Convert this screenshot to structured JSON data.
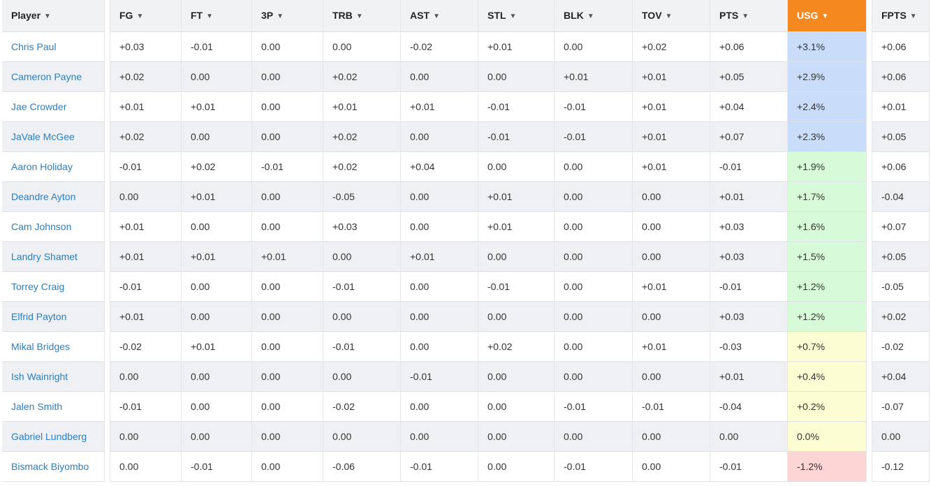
{
  "headers": {
    "player": "Player",
    "stats": [
      "FG",
      "FT",
      "3P",
      "TRB",
      "AST",
      "STL",
      "BLK",
      "TOV",
      "PTS",
      "USG"
    ],
    "fpts": "FPTS"
  },
  "sort_icon": "chevron-down-icon",
  "colors": {
    "active_sort": "#f5891f",
    "usg_blue": "#c9ddfb",
    "usg_green": "#d7fbd8",
    "usg_yellow": "#fdfdd3",
    "usg_red": "#fdd5d5",
    "player_link": "#2a7fc1"
  },
  "rows": [
    {
      "player": "Chris Paul",
      "stats": [
        "+0.03",
        "-0.01",
        "0.00",
        "0.00",
        "-0.02",
        "+0.01",
        "0.00",
        "+0.02",
        "+0.06",
        "+3.1%"
      ],
      "fpts": "+0.06",
      "usg_tier": "blue"
    },
    {
      "player": "Cameron Payne",
      "stats": [
        "+0.02",
        "0.00",
        "0.00",
        "+0.02",
        "0.00",
        "0.00",
        "+0.01",
        "+0.01",
        "+0.05",
        "+2.9%"
      ],
      "fpts": "+0.06",
      "usg_tier": "blue"
    },
    {
      "player": "Jae Crowder",
      "stats": [
        "+0.01",
        "+0.01",
        "0.00",
        "+0.01",
        "+0.01",
        "-0.01",
        "-0.01",
        "+0.01",
        "+0.04",
        "+2.4%"
      ],
      "fpts": "+0.01",
      "usg_tier": "blue"
    },
    {
      "player": "JaVale McGee",
      "stats": [
        "+0.02",
        "0.00",
        "0.00",
        "+0.02",
        "0.00",
        "-0.01",
        "-0.01",
        "+0.01",
        "+0.07",
        "+2.3%"
      ],
      "fpts": "+0.05",
      "usg_tier": "blue"
    },
    {
      "player": "Aaron Holiday",
      "stats": [
        "-0.01",
        "+0.02",
        "-0.01",
        "+0.02",
        "+0.04",
        "0.00",
        "0.00",
        "+0.01",
        "-0.01",
        "+1.9%"
      ],
      "fpts": "+0.06",
      "usg_tier": "green"
    },
    {
      "player": "Deandre Ayton",
      "stats": [
        "0.00",
        "+0.01",
        "0.00",
        "-0.05",
        "0.00",
        "+0.01",
        "0.00",
        "0.00",
        "+0.01",
        "+1.7%"
      ],
      "fpts": "-0.04",
      "usg_tier": "green"
    },
    {
      "player": "Cam Johnson",
      "stats": [
        "+0.01",
        "0.00",
        "0.00",
        "+0.03",
        "0.00",
        "+0.01",
        "0.00",
        "0.00",
        "+0.03",
        "+1.6%"
      ],
      "fpts": "+0.07",
      "usg_tier": "green"
    },
    {
      "player": "Landry Shamet",
      "stats": [
        "+0.01",
        "+0.01",
        "+0.01",
        "0.00",
        "+0.01",
        "0.00",
        "0.00",
        "0.00",
        "+0.03",
        "+1.5%"
      ],
      "fpts": "+0.05",
      "usg_tier": "green"
    },
    {
      "player": "Torrey Craig",
      "stats": [
        "-0.01",
        "0.00",
        "0.00",
        "-0.01",
        "0.00",
        "-0.01",
        "0.00",
        "+0.01",
        "-0.01",
        "+1.2%"
      ],
      "fpts": "-0.05",
      "usg_tier": "green"
    },
    {
      "player": "Elfrid Payton",
      "stats": [
        "+0.01",
        "0.00",
        "0.00",
        "0.00",
        "0.00",
        "0.00",
        "0.00",
        "0.00",
        "+0.03",
        "+1.2%"
      ],
      "fpts": "+0.02",
      "usg_tier": "green"
    },
    {
      "player": "Mikal Bridges",
      "stats": [
        "-0.02",
        "+0.01",
        "0.00",
        "-0.01",
        "0.00",
        "+0.02",
        "0.00",
        "+0.01",
        "-0.03",
        "+0.7%"
      ],
      "fpts": "-0.02",
      "usg_tier": "yellow"
    },
    {
      "player": "Ish Wainright",
      "stats": [
        "0.00",
        "0.00",
        "0.00",
        "0.00",
        "-0.01",
        "0.00",
        "0.00",
        "0.00",
        "+0.01",
        "+0.4%"
      ],
      "fpts": "+0.04",
      "usg_tier": "yellow"
    },
    {
      "player": "Jalen Smith",
      "stats": [
        "-0.01",
        "0.00",
        "0.00",
        "-0.02",
        "0.00",
        "0.00",
        "-0.01",
        "-0.01",
        "-0.04",
        "+0.2%"
      ],
      "fpts": "-0.07",
      "usg_tier": "yellow"
    },
    {
      "player": "Gabriel Lundberg",
      "stats": [
        "0.00",
        "0.00",
        "0.00",
        "0.00",
        "0.00",
        "0.00",
        "0.00",
        "0.00",
        "0.00",
        "0.0%"
      ],
      "fpts": "0.00",
      "usg_tier": "yellow"
    },
    {
      "player": "Bismack Biyombo",
      "stats": [
        "0.00",
        "-0.01",
        "0.00",
        "-0.06",
        "-0.01",
        "0.00",
        "-0.01",
        "0.00",
        "-0.01",
        "-1.2%"
      ],
      "fpts": "-0.12",
      "usg_tier": "red"
    }
  ]
}
